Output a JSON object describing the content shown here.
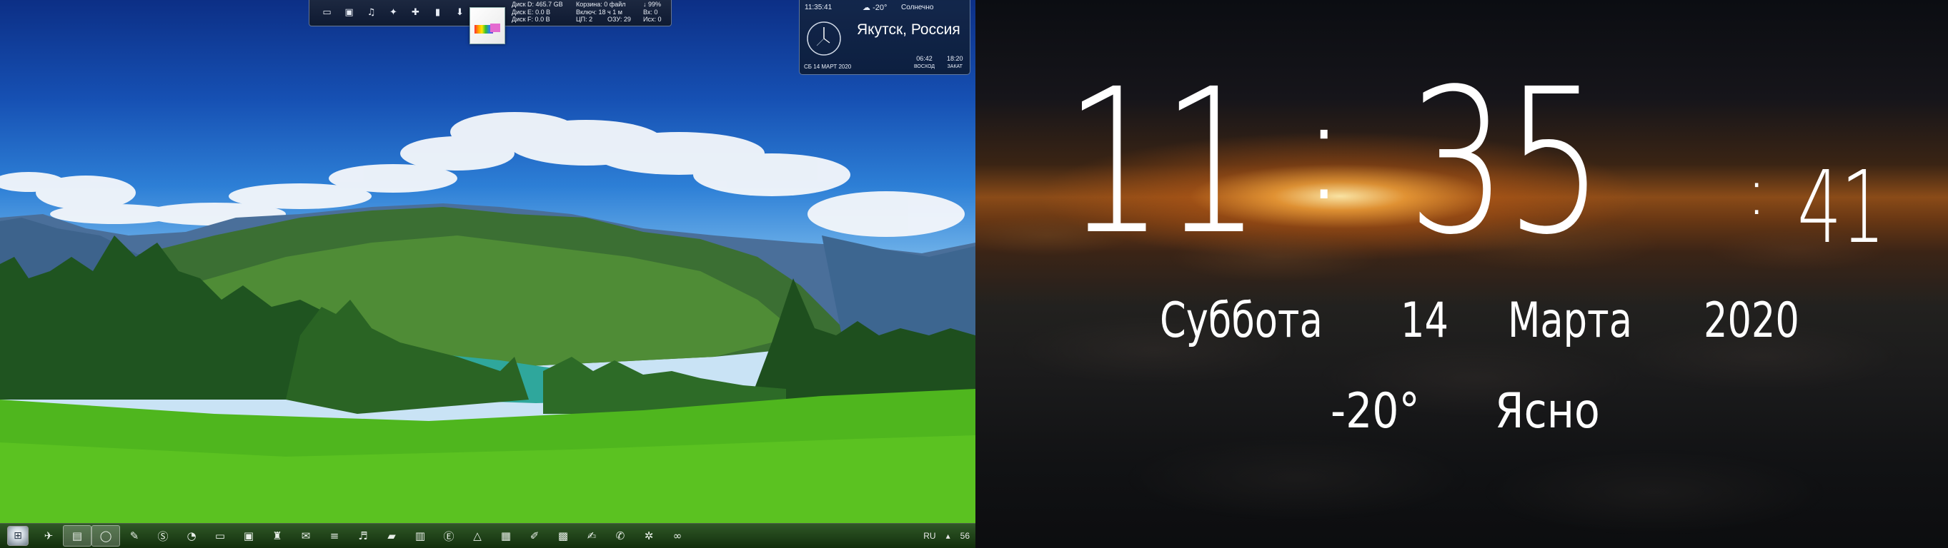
{
  "dock": {
    "icons": [
      "monitor-icon",
      "image-icon",
      "music-icon",
      "puzzle-icon",
      "thumbs-up-icon",
      "file-icon",
      "download-icon"
    ],
    "stats": [
      [
        "Диск D: 465.7 GB",
        "Корзина: 0 файл",
        "↓ 99%"
      ],
      [
        "Диск E: 0.0 B",
        "Включ: 18 ч 1 м",
        "Вх: 0"
      ],
      [
        "Диск F: 0.0 B",
        "ЦП: 2",
        "ОЗУ: 29",
        "Исх: 0"
      ]
    ]
  },
  "weather_widget": {
    "time": "11:35:41",
    "temp": "-20°",
    "condition": "Солнечно",
    "city": "Якутск, Россия",
    "date": "СБ 14 МАРТ 2020",
    "sunrise_time": "06:42",
    "sunrise_label": "ВОСХОД",
    "sunset_time": "18:20",
    "sunset_label": "ЗАКАТ"
  },
  "taskbar": {
    "icons": [
      "airplane-icon",
      "folder-icon",
      "browser-icon",
      "paint-icon",
      "skype-icon",
      "clock-icon",
      "window-icon",
      "save-icon",
      "tool-icon",
      "mail-icon",
      "notes-icon",
      "headphones-icon",
      "folder-open-icon",
      "book-icon",
      "word-icon",
      "vector-icon",
      "document-icon",
      "pen-icon",
      "calculator-icon",
      "edit-icon",
      "chat-icon",
      "settings-icon",
      "link-icon"
    ],
    "language": "RU",
    "tray_arrow": "▴",
    "tray_value": "56"
  },
  "clock": {
    "hours": "11",
    "minutes": "35",
    "seconds": "41",
    "separator": ":",
    "weekday": "Суббота",
    "day": "14",
    "month": "Марта",
    "year": "2020",
    "temperature": "-20°",
    "condition": "Ясно"
  }
}
